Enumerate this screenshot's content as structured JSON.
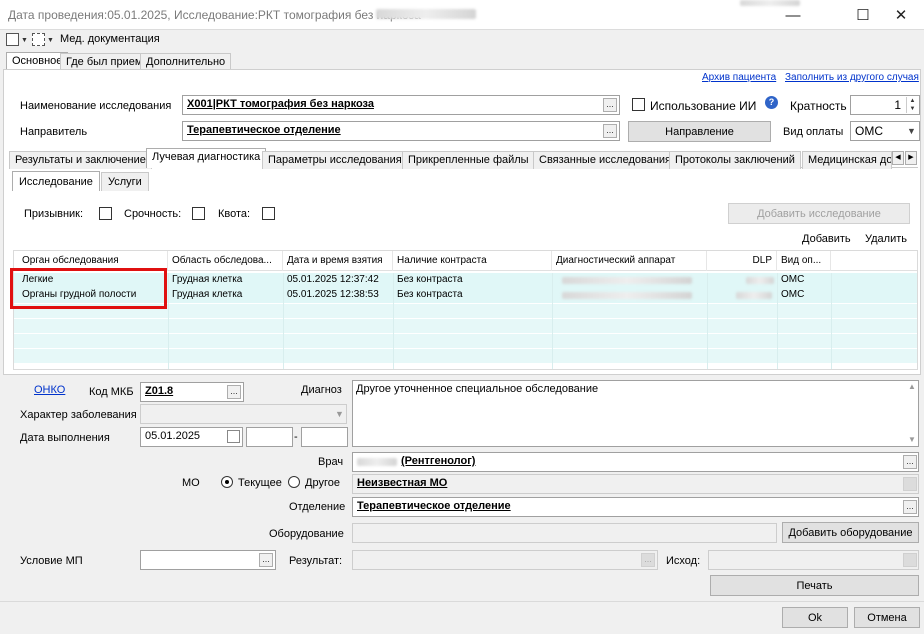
{
  "window": {
    "title": "Дата проведения:05.01.2025, Исследование:РКТ томография без наркоза - ",
    "minimize": "—",
    "maximize": "☐",
    "close": "✕"
  },
  "toolbar": {
    "med_docs_label": "Мед. документация"
  },
  "top_tabs": [
    "Основное",
    "Где был прием",
    "Дополнительно"
  ],
  "links": {
    "patient_archive": "Архив пациента",
    "fill_from_other": "Заполнить из другого случая"
  },
  "form": {
    "study_name_label": "Наименование исследования",
    "study_name_value": "X001|РКТ томография без наркоза",
    "ai_use_label": "Использование ИИ",
    "multiplicity_label": "Кратность",
    "multiplicity_value": "1",
    "referrer_label": "Направитель",
    "referrer_value": "Терапевтическое отделение",
    "referral_button": "Направление",
    "payment_label": "Вид оплаты",
    "payment_value": "ОМС"
  },
  "main_tabs": [
    "Результаты и заключение",
    "Лучевая диагностика",
    "Параметры исследования",
    "Прикрепленные файлы",
    "Связанные исследования",
    "Протоколы заключений",
    "Медицинская до"
  ],
  "sub_tabs": [
    "Исследование",
    "Услуги"
  ],
  "flags": {
    "conscript": "Призывник:",
    "urgency": "Срочность:",
    "quota": "Квота:"
  },
  "grid_actions": {
    "add_study": "Добавить исследование",
    "add": "Добавить",
    "delete": "Удалить"
  },
  "grid": {
    "columns": [
      "Орган обследования",
      "Область обследова...",
      "Дата и время взятия",
      "Наличие контраста",
      "Диагностический аппарат",
      "DLP",
      "Вид оп..."
    ],
    "rows": [
      {
        "organ": "Легкие",
        "area": "Грудная клетка",
        "datetime": "05.01.2025 12:37:42",
        "contrast": "Без контраста",
        "payment": "ОМС"
      },
      {
        "organ": "Органы грудной полости",
        "area": "Грудная клетка",
        "datetime": "05.01.2025 12:38:53",
        "contrast": "Без контраста",
        "payment": "ОМС"
      }
    ]
  },
  "bottom": {
    "onko_link": "ОНКО",
    "mkb_label": "Код МКБ",
    "mkb_value": "Z01.8",
    "diagnosis_label": "Диагноз",
    "diagnosis_value": "Другое уточненное специальное обследование",
    "disease_nature_label": "Характер заболевания",
    "exec_date_label": "Дата выполнения",
    "exec_date_value": "05.01.2025",
    "time_sep": "-",
    "doctor_label": "Врач",
    "doctor_value": "(Рентгенолог)",
    "mo_label": "МО",
    "mo_current": "Текущее",
    "mo_other": "Другое",
    "mo_value": "Неизвестная МО",
    "department_label": "Отделение",
    "department_value": "Терапевтическое отделение",
    "equipment_label": "Оборудование",
    "add_equipment_button": "Добавить оборудование",
    "mp_condition_label": "Условие МП",
    "result_label": "Результат:",
    "outcome_label": "Исход:",
    "print_button": "Печать",
    "ok_button": "Ok",
    "cancel_button": "Отмена"
  }
}
